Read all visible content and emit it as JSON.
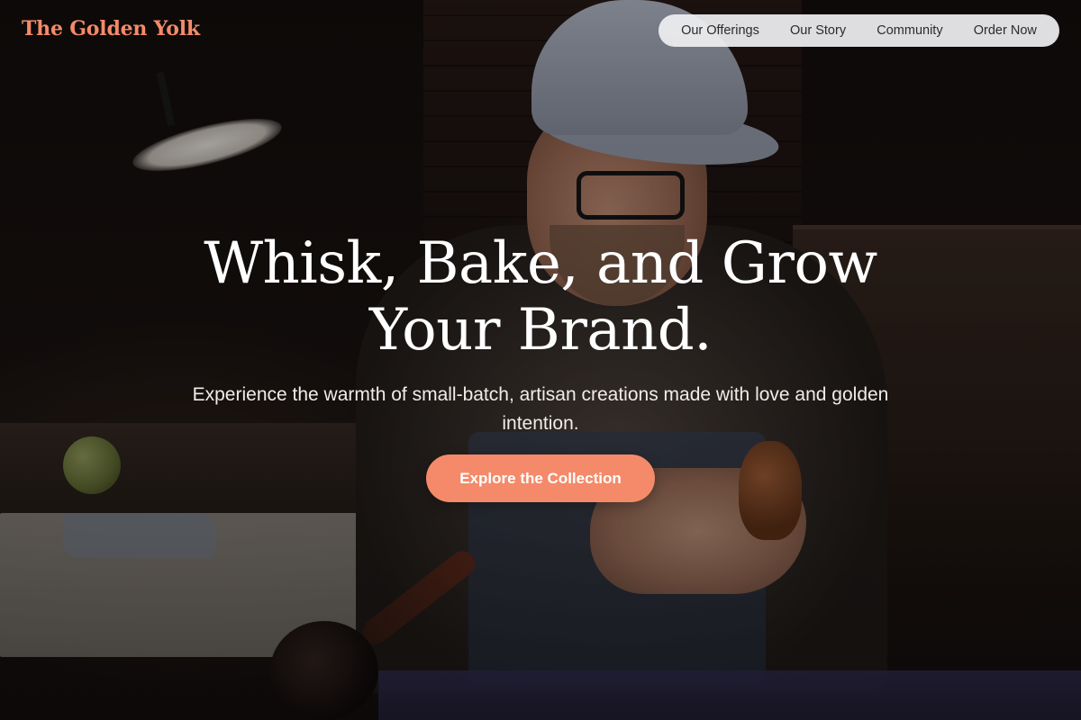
{
  "brand": {
    "name": "The Golden Yolk",
    "color": "#f48a6a"
  },
  "nav": {
    "items": [
      {
        "label": "Our Offerings"
      },
      {
        "label": "Our Story"
      },
      {
        "label": "Community"
      },
      {
        "label": "Order Now"
      }
    ]
  },
  "hero": {
    "title_line1": "Whisk, Bake, and Grow",
    "title_line2": "Your Brand.",
    "subtitle": "Experience the warmth of small-batch, artisan creations made with love and golden intention.",
    "cta_label": "Explore the Collection",
    "cta_color": "#f48a6a",
    "background_image_subject": "artisan in cap and glasses working at a workshop bench under a lamp"
  }
}
